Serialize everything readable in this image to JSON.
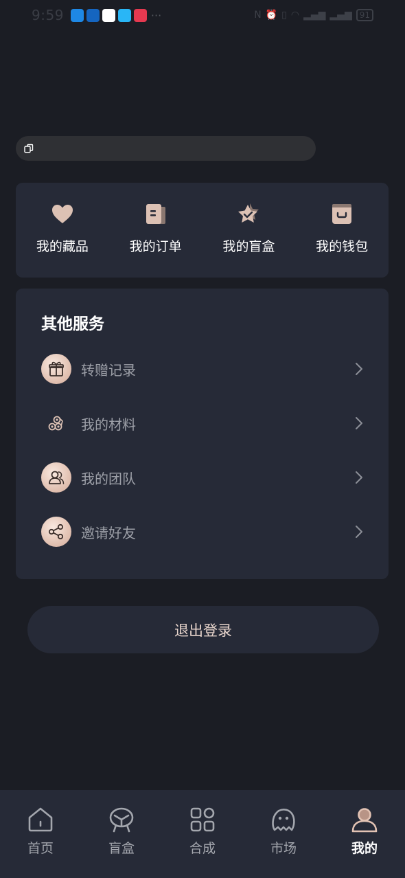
{
  "status_bar": {
    "time": "9:59",
    "more": "···",
    "battery": "91",
    "app_colors": [
      "#1e88e5",
      "#1565c0",
      "#ffffff",
      "#29b6f6",
      "#e53950"
    ]
  },
  "quick_actions": [
    {
      "label": "我的藏品",
      "icon": "heart-icon"
    },
    {
      "label": "我的订单",
      "icon": "order-doc-icon"
    },
    {
      "label": "我的盲盒",
      "icon": "star-badge-icon"
    },
    {
      "label": "我的钱包",
      "icon": "wallet-icon"
    }
  ],
  "services": {
    "title": "其他服务",
    "items": [
      {
        "label": "转赠记录",
        "icon": "gift-icon"
      },
      {
        "label": "我的材料",
        "icon": "materials-icon"
      },
      {
        "label": "我的团队",
        "icon": "team-icon"
      },
      {
        "label": "邀请好友",
        "icon": "share-icon"
      }
    ]
  },
  "logout_label": "退出登录",
  "tabbar": {
    "items": [
      {
        "label": "首页",
        "icon": "home-icon"
      },
      {
        "label": "盲盒",
        "icon": "blindbox-icon"
      },
      {
        "label": "合成",
        "icon": "grid-icon"
      },
      {
        "label": "市场",
        "icon": "market-icon"
      },
      {
        "label": "我的",
        "icon": "profile-icon"
      }
    ],
    "active": "我的"
  },
  "colors": {
    "background": "#1b1d24",
    "card": "#262a37",
    "accent": "#e3c3b4",
    "muted_text": "#9da0a8"
  }
}
